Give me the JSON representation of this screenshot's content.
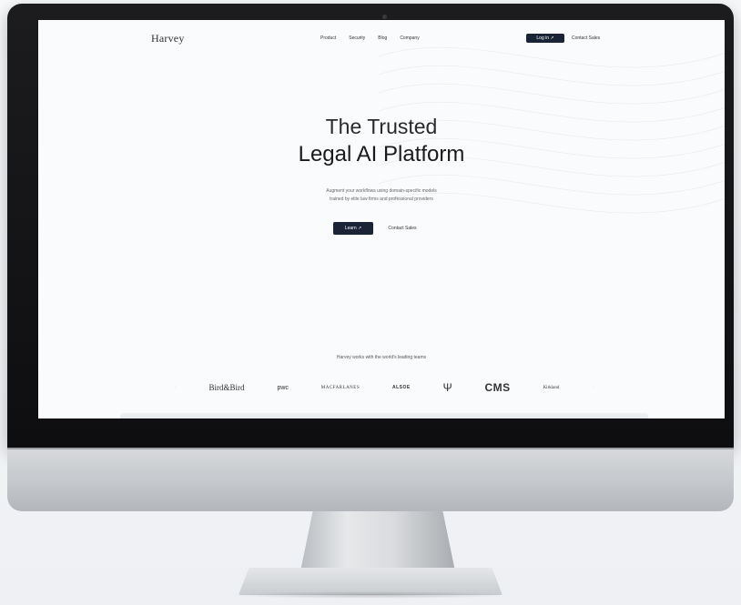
{
  "site": {
    "logo": "Harvey",
    "nav_links": [
      "Product",
      "Security",
      "Blog",
      "Company"
    ],
    "login_label": "Log in ↗",
    "contact_label": "Contact Sales"
  },
  "hero": {
    "title_line1": "The Trusted",
    "title_line2": "Legal AI Platform",
    "subtitle_line1": "Augment your workflows using domain-specific models",
    "subtitle_line2": "trained by elite law firms and professional providers",
    "primary_cta": "Learn ↗",
    "secondary_cta": "Contact Sales"
  },
  "trust": {
    "heading": "Harvey works with the world's leading teams",
    "logos": [
      "Bird&Bird",
      "pwc",
      "MACFARLANES",
      "ALSOE",
      "Ψ",
      "CMS",
      "Kirkland"
    ]
  },
  "colors": {
    "primary_button": "#1b2437",
    "bezel": "#111113",
    "screen_bg": "#fafbfc"
  }
}
